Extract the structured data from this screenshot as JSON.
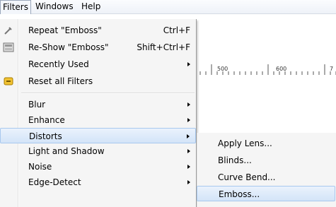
{
  "menubar": {
    "filters": "Filters",
    "windows": "Windows",
    "help": "Help"
  },
  "ruler": {
    "ticks": [
      "500",
      "600",
      "7"
    ]
  },
  "menu": {
    "items": [
      {
        "label": "Repeat \"Emboss\"",
        "shortcut": "Ctrl+F",
        "icon": "repeat-icon"
      },
      {
        "label": "Re-Show \"Emboss\"",
        "shortcut": "Shift+Ctrl+F",
        "icon": "reshow-icon"
      },
      {
        "label": "Recently Used",
        "icon": "",
        "submenu": true
      },
      {
        "label": "Reset all Filters",
        "icon": "reset-icon"
      },
      {
        "label": "Blur",
        "submenu": true
      },
      {
        "label": "Enhance",
        "submenu": true
      },
      {
        "label": "Distorts",
        "submenu": true,
        "selected": true
      },
      {
        "label": "Light and Shadow",
        "submenu": true
      },
      {
        "label": "Noise",
        "submenu": true
      },
      {
        "label": "Edge-Detect",
        "submenu": true
      }
    ]
  },
  "submenu": {
    "items": [
      {
        "label": "Apply Lens..."
      },
      {
        "label": "Blinds..."
      },
      {
        "label": "Curve Bend..."
      },
      {
        "label": "Emboss...",
        "selected": true
      }
    ]
  },
  "colors": {
    "highlight_top": "#eaf2fc",
    "highlight_bottom": "#d3e4f8",
    "highlight_border": "#a8c8ee",
    "menu_bg": "#f5f5f5"
  }
}
